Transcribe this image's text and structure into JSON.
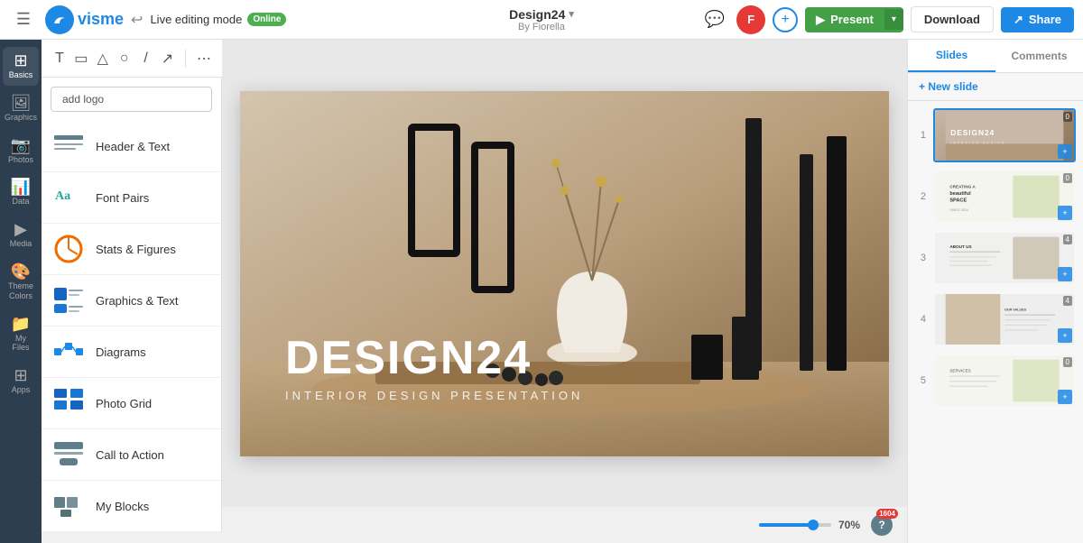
{
  "topbar": {
    "logo_text": "visme",
    "undo_icon": "↩",
    "live_mode_label": "Live editing mode",
    "live_badge": "Online",
    "design_title": "Design24",
    "design_subtitle": "By Fiorella",
    "chevron": "▾",
    "chat_icon": "💬",
    "avatar_initials": "F",
    "add_icon": "+",
    "present_label": "Present",
    "present_chevron": "▾",
    "download_label": "Download",
    "share_label": "Share",
    "share_icon": "↗"
  },
  "toolbar": {
    "text_tool": "T",
    "rect_tool": "▭",
    "triangle_tool": "△",
    "circle_tool": "○",
    "line_tool": "/",
    "arrow_tool": "↗",
    "more_tool": "⋯"
  },
  "sidebar": {
    "items": [
      {
        "id": "basics",
        "icon": "⊞",
        "label": "Basics"
      },
      {
        "id": "graphics",
        "icon": "🖼",
        "label": "Graphics"
      },
      {
        "id": "photos",
        "icon": "📷",
        "label": "Photos"
      },
      {
        "id": "data",
        "icon": "📊",
        "label": "Data"
      },
      {
        "id": "media",
        "icon": "▶",
        "label": "Media"
      },
      {
        "id": "theme-colors",
        "icon": "🎨",
        "label": "Theme Colors"
      },
      {
        "id": "my-files",
        "icon": "📁",
        "label": "My Files"
      },
      {
        "id": "apps",
        "icon": "⊞",
        "label": "Apps"
      }
    ]
  },
  "blocks_panel": {
    "add_logo_label": "add logo",
    "items": [
      {
        "id": "header-text",
        "label": "Header & Text",
        "icon_color": "#607d8b"
      },
      {
        "id": "font-pairs",
        "label": "Font Pairs",
        "icon_color": "#26a69a"
      },
      {
        "id": "stats-figures",
        "label": "Stats & Figures",
        "icon_color": "#ef6c00"
      },
      {
        "id": "graphics-text",
        "label": "Graphics & Text",
        "icon_color": "#1565c0"
      },
      {
        "id": "diagrams",
        "label": "Diagrams",
        "icon_color": "#1e88e5"
      },
      {
        "id": "photo-grid",
        "label": "Photo Grid",
        "icon_color": "#1565c0"
      },
      {
        "id": "call-to-action",
        "label": "Call to Action",
        "icon_color": "#607d8b"
      },
      {
        "id": "my-blocks",
        "label": "My Blocks",
        "icon_color": "#607d8b"
      }
    ]
  },
  "canvas": {
    "title": "DESIGN24",
    "subtitle": "INTERIOR DESIGN PRESENTATION",
    "zoom_pct": "70%",
    "cursor_icon": "→"
  },
  "right_panel": {
    "tab_slides": "Slides",
    "tab_comments": "Comments",
    "new_slide_label": "+ New slide",
    "slides": [
      {
        "number": "1",
        "active": true,
        "badge": "0",
        "title": "DESIGN24",
        "theme": "dark"
      },
      {
        "number": "2",
        "active": false,
        "badge": "0",
        "theme": "light-green"
      },
      {
        "number": "3",
        "active": false,
        "badge": "4",
        "theme": "light-text"
      },
      {
        "number": "4",
        "active": false,
        "badge": "4",
        "theme": "split"
      },
      {
        "number": "5",
        "active": false,
        "badge": "0",
        "theme": "light-green2"
      }
    ]
  },
  "help": {
    "icon": "?",
    "notification": "1604"
  }
}
